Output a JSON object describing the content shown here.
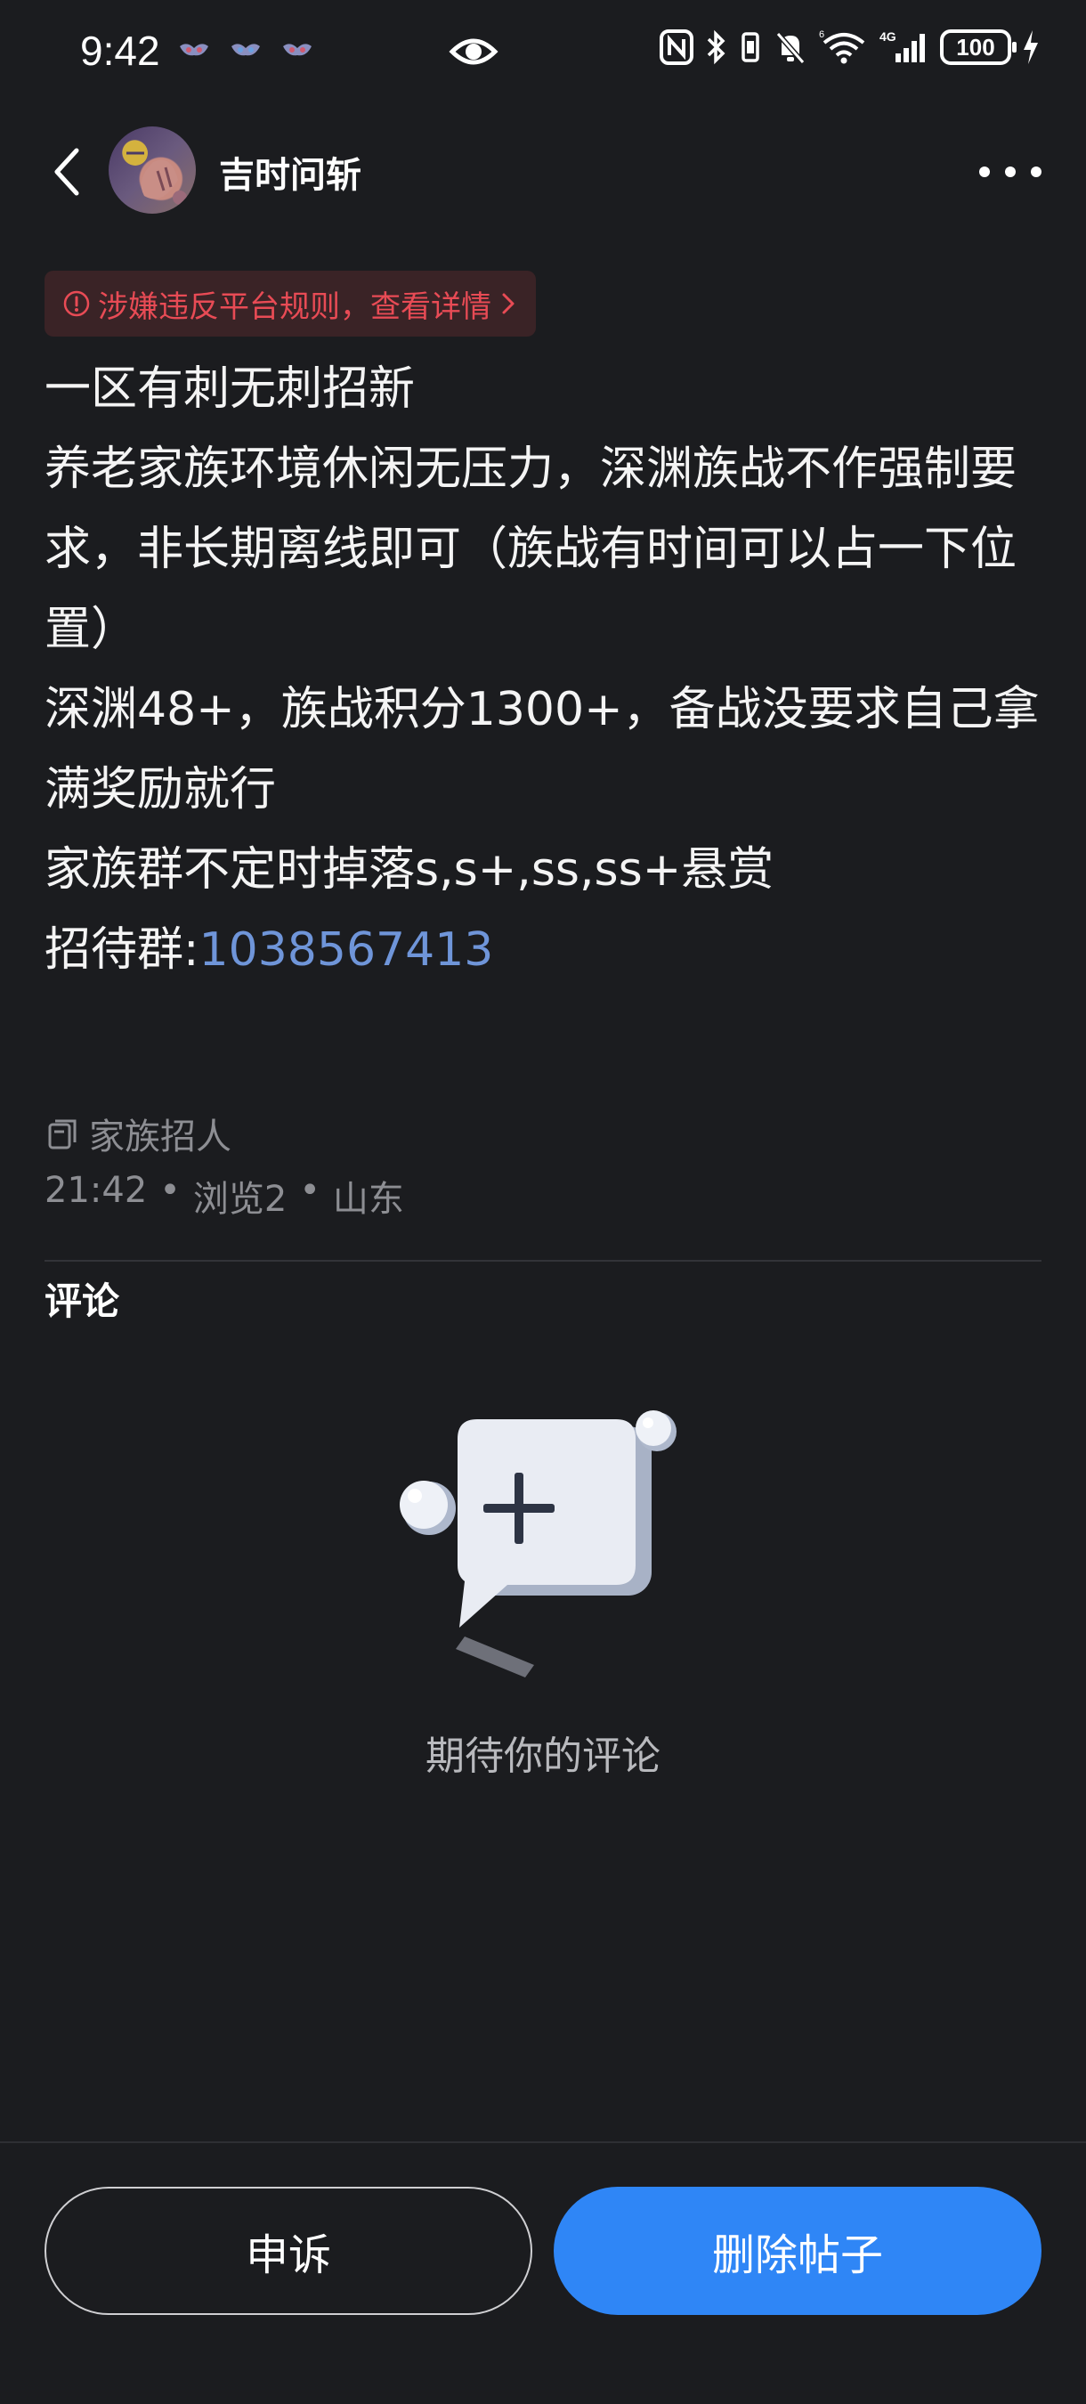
{
  "status_bar": {
    "time": "9:42",
    "battery_level": "100",
    "notification_icons": [
      "app-notification-icon",
      "app-notification-icon",
      "app-notification-icon"
    ],
    "system_icons": [
      "eye-icon",
      "nfc-icon",
      "bluetooth-icon",
      "vibrate-icon",
      "mute-icon",
      "wifi-6-icon",
      "4g-signal-icon",
      "battery-icon",
      "charging-icon"
    ]
  },
  "header": {
    "username": "吉时问斩",
    "back_icon": "chevron-left-icon",
    "more_icon": "more-horizontal-icon"
  },
  "violation_banner": {
    "text": "涉嫌违反平台规则，查看详情",
    "color": "#e84b55",
    "background": "#3a2326"
  },
  "post": {
    "lines": [
      "一区有刺无刺招新",
      "养老家族环境休闲无压力，深渊族战不作强制要求，非长期离线即可（族战有时间可以占一下位置）",
      "深渊48+，族战积分1300+，备战没要求自己拿满奖励就行",
      "家族群不定时掉落s,s+,ss,ss+悬赏"
    ],
    "contact_label": "招待群:",
    "contact_number": "1038567413"
  },
  "meta": {
    "topic": "家族招人",
    "time": "21:42",
    "views": "浏览2",
    "location": "山东",
    "separator": "•"
  },
  "comments": {
    "heading": "评论",
    "empty_text": "期待你的评论"
  },
  "actions": {
    "appeal_label": "申诉",
    "delete_label": "删除帖子",
    "delete_color": "#2f86f6"
  }
}
